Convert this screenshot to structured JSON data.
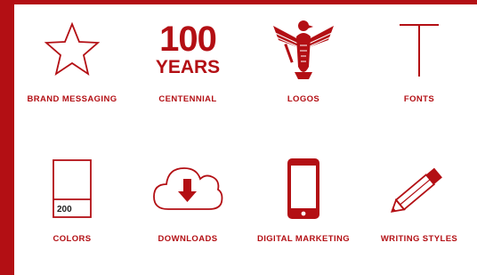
{
  "tiles": [
    {
      "label": "BRAND MESSAGING",
      "icon": "star-icon"
    },
    {
      "label": "CENTENNIAL",
      "icon": "centennial-100-years-icon",
      "number": "100",
      "word": "YEARS"
    },
    {
      "label": "LOGOS",
      "icon": "eagle-logo-icon"
    },
    {
      "label": "FONTS",
      "icon": "font-t-icon"
    },
    {
      "label": "COLORS",
      "icon": "color-swatch-icon",
      "swatch_number": "200"
    },
    {
      "label": "DOWNLOADS",
      "icon": "cloud-download-icon"
    },
    {
      "label": "DIGITAL MARKETING",
      "icon": "smartphone-icon"
    },
    {
      "label": "WRITING STYLES",
      "icon": "pencil-icon"
    }
  ],
  "colors": {
    "brand_red": "#b30f14",
    "background": "#ffffff"
  }
}
